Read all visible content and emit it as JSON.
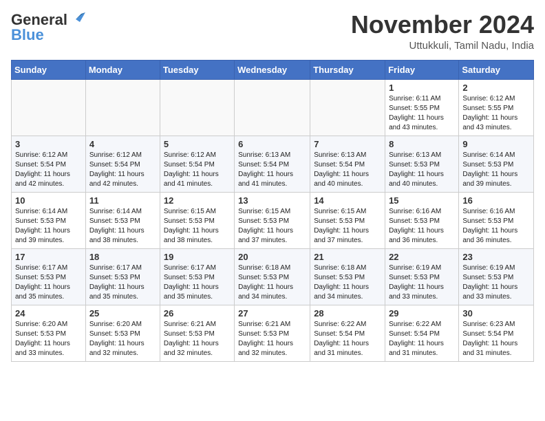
{
  "header": {
    "logo_line1": "General",
    "logo_line2": "Blue",
    "title": "November 2024",
    "subtitle": "Uttukkuli, Tamil Nadu, India"
  },
  "weekdays": [
    "Sunday",
    "Monday",
    "Tuesday",
    "Wednesday",
    "Thursday",
    "Friday",
    "Saturday"
  ],
  "weeks": [
    [
      {
        "day": "",
        "info": ""
      },
      {
        "day": "",
        "info": ""
      },
      {
        "day": "",
        "info": ""
      },
      {
        "day": "",
        "info": ""
      },
      {
        "day": "",
        "info": ""
      },
      {
        "day": "1",
        "info": "Sunrise: 6:11 AM\nSunset: 5:55 PM\nDaylight: 11 hours\nand 43 minutes."
      },
      {
        "day": "2",
        "info": "Sunrise: 6:12 AM\nSunset: 5:55 PM\nDaylight: 11 hours\nand 43 minutes."
      }
    ],
    [
      {
        "day": "3",
        "info": "Sunrise: 6:12 AM\nSunset: 5:54 PM\nDaylight: 11 hours\nand 42 minutes."
      },
      {
        "day": "4",
        "info": "Sunrise: 6:12 AM\nSunset: 5:54 PM\nDaylight: 11 hours\nand 42 minutes."
      },
      {
        "day": "5",
        "info": "Sunrise: 6:12 AM\nSunset: 5:54 PM\nDaylight: 11 hours\nand 41 minutes."
      },
      {
        "day": "6",
        "info": "Sunrise: 6:13 AM\nSunset: 5:54 PM\nDaylight: 11 hours\nand 41 minutes."
      },
      {
        "day": "7",
        "info": "Sunrise: 6:13 AM\nSunset: 5:54 PM\nDaylight: 11 hours\nand 40 minutes."
      },
      {
        "day": "8",
        "info": "Sunrise: 6:13 AM\nSunset: 5:53 PM\nDaylight: 11 hours\nand 40 minutes."
      },
      {
        "day": "9",
        "info": "Sunrise: 6:14 AM\nSunset: 5:53 PM\nDaylight: 11 hours\nand 39 minutes."
      }
    ],
    [
      {
        "day": "10",
        "info": "Sunrise: 6:14 AM\nSunset: 5:53 PM\nDaylight: 11 hours\nand 39 minutes."
      },
      {
        "day": "11",
        "info": "Sunrise: 6:14 AM\nSunset: 5:53 PM\nDaylight: 11 hours\nand 38 minutes."
      },
      {
        "day": "12",
        "info": "Sunrise: 6:15 AM\nSunset: 5:53 PM\nDaylight: 11 hours\nand 38 minutes."
      },
      {
        "day": "13",
        "info": "Sunrise: 6:15 AM\nSunset: 5:53 PM\nDaylight: 11 hours\nand 37 minutes."
      },
      {
        "day": "14",
        "info": "Sunrise: 6:15 AM\nSunset: 5:53 PM\nDaylight: 11 hours\nand 37 minutes."
      },
      {
        "day": "15",
        "info": "Sunrise: 6:16 AM\nSunset: 5:53 PM\nDaylight: 11 hours\nand 36 minutes."
      },
      {
        "day": "16",
        "info": "Sunrise: 6:16 AM\nSunset: 5:53 PM\nDaylight: 11 hours\nand 36 minutes."
      }
    ],
    [
      {
        "day": "17",
        "info": "Sunrise: 6:17 AM\nSunset: 5:53 PM\nDaylight: 11 hours\nand 35 minutes."
      },
      {
        "day": "18",
        "info": "Sunrise: 6:17 AM\nSunset: 5:53 PM\nDaylight: 11 hours\nand 35 minutes."
      },
      {
        "day": "19",
        "info": "Sunrise: 6:17 AM\nSunset: 5:53 PM\nDaylight: 11 hours\nand 35 minutes."
      },
      {
        "day": "20",
        "info": "Sunrise: 6:18 AM\nSunset: 5:53 PM\nDaylight: 11 hours\nand 34 minutes."
      },
      {
        "day": "21",
        "info": "Sunrise: 6:18 AM\nSunset: 5:53 PM\nDaylight: 11 hours\nand 34 minutes."
      },
      {
        "day": "22",
        "info": "Sunrise: 6:19 AM\nSunset: 5:53 PM\nDaylight: 11 hours\nand 33 minutes."
      },
      {
        "day": "23",
        "info": "Sunrise: 6:19 AM\nSunset: 5:53 PM\nDaylight: 11 hours\nand 33 minutes."
      }
    ],
    [
      {
        "day": "24",
        "info": "Sunrise: 6:20 AM\nSunset: 5:53 PM\nDaylight: 11 hours\nand 33 minutes."
      },
      {
        "day": "25",
        "info": "Sunrise: 6:20 AM\nSunset: 5:53 PM\nDaylight: 11 hours\nand 32 minutes."
      },
      {
        "day": "26",
        "info": "Sunrise: 6:21 AM\nSunset: 5:53 PM\nDaylight: 11 hours\nand 32 minutes."
      },
      {
        "day": "27",
        "info": "Sunrise: 6:21 AM\nSunset: 5:53 PM\nDaylight: 11 hours\nand 32 minutes."
      },
      {
        "day": "28",
        "info": "Sunrise: 6:22 AM\nSunset: 5:54 PM\nDaylight: 11 hours\nand 31 minutes."
      },
      {
        "day": "29",
        "info": "Sunrise: 6:22 AM\nSunset: 5:54 PM\nDaylight: 11 hours\nand 31 minutes."
      },
      {
        "day": "30",
        "info": "Sunrise: 6:23 AM\nSunset: 5:54 PM\nDaylight: 11 hours\nand 31 minutes."
      }
    ]
  ]
}
